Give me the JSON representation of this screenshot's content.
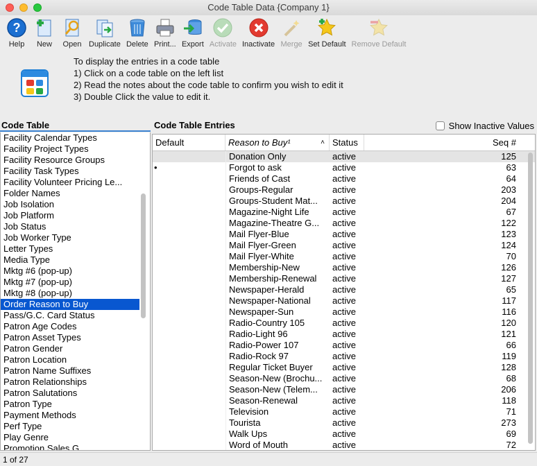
{
  "window": {
    "title": "Code Table Data {Company 1}"
  },
  "toolbar": {
    "items": [
      {
        "label": "Help",
        "icon": "help-icon",
        "enabled": true
      },
      {
        "label": "New",
        "icon": "new-icon",
        "enabled": true
      },
      {
        "label": "Open",
        "icon": "open-icon",
        "enabled": true
      },
      {
        "label": "Duplicate",
        "icon": "duplicate-icon",
        "enabled": true
      },
      {
        "label": "Delete",
        "icon": "delete-icon",
        "enabled": true
      },
      {
        "label": "Print...",
        "icon": "print-icon",
        "enabled": true
      },
      {
        "label": "Export",
        "icon": "export-icon",
        "enabled": true
      },
      {
        "label": "Activate",
        "icon": "activate-icon",
        "enabled": false
      },
      {
        "label": "Inactivate",
        "icon": "inactivate-icon",
        "enabled": true
      },
      {
        "label": "Merge",
        "icon": "merge-icon",
        "enabled": false
      },
      {
        "label": "Set Default",
        "icon": "set-default-icon",
        "enabled": true
      },
      {
        "label": "Remove Default",
        "icon": "remove-default-icon",
        "enabled": false
      }
    ]
  },
  "instructions": {
    "line1": "To display the entries in a code table",
    "line2": "1) Click on a code table on the left list",
    "line3": "2) Read the notes about the code table to confirm you wish to edit it",
    "line4": "3) Double Click the value to edit it."
  },
  "code_table": {
    "header": "Code Table",
    "selected": "Order Reason to Buy",
    "items": [
      "Facility Calendar Types",
      "Facility Project Types",
      "Facility Resource Groups",
      "Facility Task Types",
      "Facility Volunteer Pricing Le...",
      "Folder Names",
      "Job Isolation",
      "Job Platform",
      "Job Status",
      "Job Worker Type",
      "Letter Types",
      "Media Type",
      "Mktg #6 (pop-up)",
      "Mktg #7 (pop-up)",
      "Mktg #8 (pop-up)",
      "Order Reason to Buy",
      "Pass/G.C. Card Status",
      "Patron Age Codes",
      "Patron Asset Types",
      "Patron Gender",
      "Patron Location",
      "Patron Name Suffixes",
      "Patron Relationships",
      "Patron Salutations",
      "Patron Type",
      "Payment Methods",
      "Perf Type",
      "Play Genre",
      "Promotion Sales G..."
    ]
  },
  "entries": {
    "header": "Code Table Entries",
    "show_inactive_label": "Show Inactive Values",
    "show_inactive_checked": false,
    "columns": {
      "default": "Default",
      "reason": "Reason to Buy¹",
      "sort_indicator": "˄",
      "status": "Status",
      "seq": "Seq #"
    },
    "rows": [
      {
        "default": "",
        "reason": "Donation Only",
        "status": "active",
        "seq": "125"
      },
      {
        "default": "•",
        "reason": "Forgot to ask",
        "status": "active",
        "seq": "63"
      },
      {
        "default": "",
        "reason": "Friends of Cast",
        "status": "active",
        "seq": "64"
      },
      {
        "default": "",
        "reason": "Groups-Regular",
        "status": "active",
        "seq": "203"
      },
      {
        "default": "",
        "reason": "Groups-Student Mat...",
        "status": "active",
        "seq": "204"
      },
      {
        "default": "",
        "reason": "Magazine-Night Life",
        "status": "active",
        "seq": "67"
      },
      {
        "default": "",
        "reason": "Magazine-Theatre G...",
        "status": "active",
        "seq": "122"
      },
      {
        "default": "",
        "reason": "Mail Flyer-Blue",
        "status": "active",
        "seq": "123"
      },
      {
        "default": "",
        "reason": "Mail Flyer-Green",
        "status": "active",
        "seq": "124"
      },
      {
        "default": "",
        "reason": "Mail Flyer-White",
        "status": "active",
        "seq": "70"
      },
      {
        "default": "",
        "reason": "Membership-New",
        "status": "active",
        "seq": "126"
      },
      {
        "default": "",
        "reason": "Membership-Renewal",
        "status": "active",
        "seq": "127"
      },
      {
        "default": "",
        "reason": "Newspaper-Herald",
        "status": "active",
        "seq": "65"
      },
      {
        "default": "",
        "reason": "Newspaper-National",
        "status": "active",
        "seq": "117"
      },
      {
        "default": "",
        "reason": "Newspaper-Sun",
        "status": "active",
        "seq": "116"
      },
      {
        "default": "",
        "reason": "Radio-Country 105",
        "status": "active",
        "seq": "120"
      },
      {
        "default": "",
        "reason": "Radio-Light 96",
        "status": "active",
        "seq": "121"
      },
      {
        "default": "",
        "reason": "Radio-Power 107",
        "status": "active",
        "seq": "66"
      },
      {
        "default": "",
        "reason": "Radio-Rock 97",
        "status": "active",
        "seq": "119"
      },
      {
        "default": "",
        "reason": "Regular Ticket Buyer",
        "status": "active",
        "seq": "128"
      },
      {
        "default": "",
        "reason": "Season-New (Brochu...",
        "status": "active",
        "seq": "68"
      },
      {
        "default": "",
        "reason": "Season-New (Telem...",
        "status": "active",
        "seq": "206"
      },
      {
        "default": "",
        "reason": "Season-Renewal",
        "status": "active",
        "seq": "118"
      },
      {
        "default": "",
        "reason": "Television",
        "status": "active",
        "seq": "71"
      },
      {
        "default": "",
        "reason": "Tourista",
        "status": "active",
        "seq": "273"
      },
      {
        "default": "",
        "reason": "Walk Ups",
        "status": "active",
        "seq": "69"
      },
      {
        "default": "",
        "reason": "Word of Mouth",
        "status": "active",
        "seq": "72"
      }
    ]
  },
  "status_bar": {
    "text": "1 of 27"
  },
  "colors": {
    "selection": "#0857d0",
    "accent": "#3b82d1"
  }
}
